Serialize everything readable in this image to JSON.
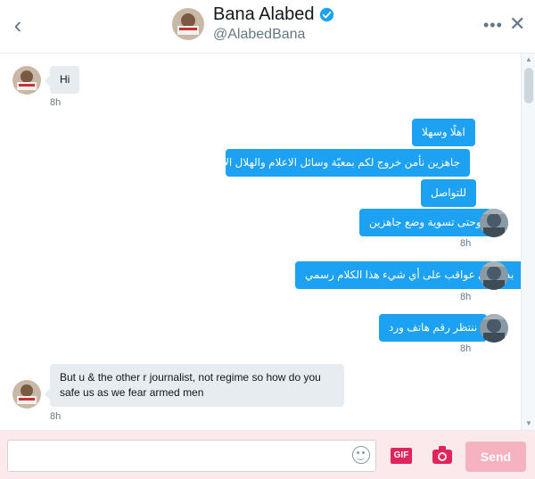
{
  "header": {
    "name": "Bana Alabed",
    "handle": "@AlabedBana",
    "back_icon": "chevron-left-icon",
    "verified_icon": "verified-badge-icon",
    "more_icon": "more-options-icon",
    "close_icon": "close-icon"
  },
  "messages": [
    {
      "direction": "in",
      "text": "Hi",
      "time": "8h"
    },
    {
      "direction": "out",
      "text": "اهلًا وسهلا"
    },
    {
      "direction": "out",
      "text": "جاهزين نأمن خروج لكم بمعيّة وسائل الاعلام والهلال الأحمر بدنا رقم هاتف"
    },
    {
      "direction": "out",
      "text": "للتواصل"
    },
    {
      "direction": "out",
      "text": "وحتى تسوية وضع جاهزين",
      "time": "8h"
    },
    {
      "direction": "out",
      "text": "بدون أي عواقب على أي شيء هذا الكلام رسمي",
      "time": "8h"
    },
    {
      "direction": "out",
      "text": "ننتظر رقم هاتف ورد",
      "time": "8h"
    },
    {
      "direction": "in",
      "text": "But u & the other r journalist, not regime so how do you safe us as we fear armed men",
      "time": "8h"
    }
  ],
  "composer": {
    "placeholder": "",
    "emoji_icon": "emoji-icon",
    "gif_label": "GIF",
    "camera_icon": "camera-icon",
    "send_label": "Send"
  },
  "colors": {
    "accent_blue": "#1da1f2",
    "incoming_bubble": "#e6ecf0",
    "composer_bg": "#fbe9ec",
    "gif_red": "#e0245e",
    "send_disabled": "#f7b2c0"
  }
}
